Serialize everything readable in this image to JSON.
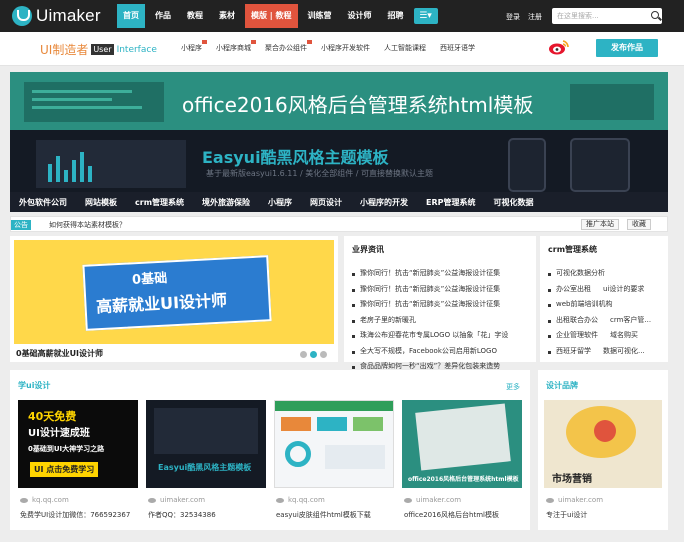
{
  "header": {
    "logo_text": "Uimaker",
    "nav": [
      "首页",
      "作品",
      "教程",
      "素材",
      "模版 | 教程",
      "训练营",
      "设计师",
      "招聘"
    ],
    "login": "登录",
    "register": "注册",
    "search_placeholder": "在这里搜索..."
  },
  "subnav": {
    "brand_cn": "UI制造者",
    "brand_ui": "User",
    "brand_iface": "Interface",
    "categories": [
      "小程序",
      "小程序商城",
      "聚合办公组件",
      "小程序开发软件",
      "人工智能课程",
      "西班牙语学"
    ],
    "publish_label": "发布作品"
  },
  "banner1": {
    "title": "office2016风格后台管理系统html模板"
  },
  "banner2": {
    "title": "Easyui酷黑风格主题模板",
    "subtitle": "基于最新版easyui1.6.11 / 美化全部组件 / 可直接替换默认主题"
  },
  "category_strip": [
    "外包软件公司",
    "网站模板",
    "crm管理系统",
    "境外旅游保险",
    "小程序",
    "网页设计",
    "小程序的开发",
    "ERP管理系统",
    "可视化数据"
  ],
  "notice": {
    "tag": "公告",
    "text": "如何获得本站素材模板？",
    "recommend": "推广本站",
    "collect": "收藏"
  },
  "feature": {
    "line1": "0基础",
    "line2": "高薪就业UI设计师",
    "caption": "0基础高薪就业UI设计师"
  },
  "news": {
    "title": "业界资讯",
    "items": [
      "豫你同行！抗击“新冠肺炎”公益海报设计征集",
      "豫你同行！抗击“新冠肺炎”公益海报设计征集",
      "豫你同行！抗击“新冠肺炎”公益海报设计征集",
      "老房子里的新暖孔",
      "珠海公布迎春花市专属LOGO 以抽象「花」字设",
      "全大写不规模，Facebook公司启用新LOGO",
      "食品品牌如何一秒“出戏”？差异化包装来造势"
    ]
  },
  "crm": {
    "title": "crm管理系统",
    "items": [
      {
        "a": "可视化数据分析",
        "b": ""
      },
      {
        "a": "办公室出租",
        "b": "ui设计的要求"
      },
      {
        "a": "web前端培训机构",
        "b": ""
      },
      {
        "a": "出租联合办公",
        "b": "crm客户管..."
      },
      {
        "a": "企业管理软件",
        "b": "域名购买"
      },
      {
        "a": "西班牙留学",
        "b": "数据可视化..."
      }
    ]
  },
  "ui_section": {
    "title": "学ui设计",
    "more": "更多",
    "tiles": [
      {
        "l1": "40天免费",
        "l2": "UI设计速成班",
        "l3": "0基础到UI大神学习之路",
        "l4": "UI 点击免费学习",
        "source": "kq.qq.com",
        "title": "免费学UI设计加微信：766592367"
      },
      {
        "l1": "Easyui酷黑风格主题模板",
        "source": "uimaker.com",
        "title": "作者QQ：32534386"
      },
      {
        "source": "kq.qq.com",
        "title": "easyui皮肤组件html模板下载"
      },
      {
        "caption": "office2016风格后台管理系统html模板",
        "source": "uimaker.com",
        "title": "office2016风格后台html模板"
      }
    ]
  },
  "brand_section": {
    "title": "设计品牌",
    "tile_label": "市场营销",
    "source": "uimaker.com",
    "title2": "专注于ui设计"
  },
  "colors": {
    "accent": "#2db3c4",
    "dark": "#222222",
    "orange": "#e8883a",
    "red": "#e0543d"
  }
}
